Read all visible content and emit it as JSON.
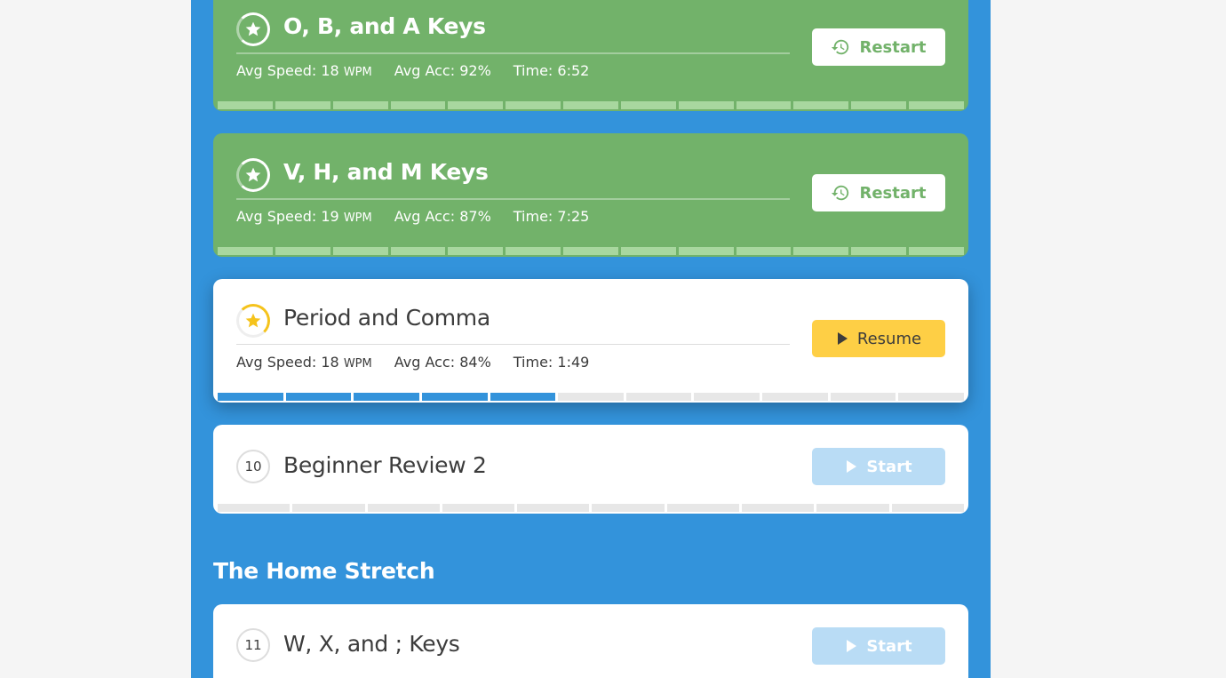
{
  "lessons": [
    {
      "id": "l1",
      "title": "O, B, and A Keys",
      "speed_label": "Avg Speed:",
      "speed_value": "18",
      "speed_unit": "WPM",
      "acc_label": "Avg Acc:",
      "acc_value": "92%",
      "time_label": "Time:",
      "time_value": "6:52",
      "button_label": "Restart",
      "state": "complete",
      "segments_total": 13,
      "segments_done": 13
    },
    {
      "id": "l2",
      "title": "V, H, and M Keys",
      "speed_label": "Avg Speed:",
      "speed_value": "19",
      "speed_unit": "WPM",
      "acc_label": "Avg Acc:",
      "acc_value": "87%",
      "time_label": "Time:",
      "time_value": "7:25",
      "button_label": "Restart",
      "state": "complete",
      "segments_total": 13,
      "segments_done": 13
    },
    {
      "id": "l3",
      "title": "Period and Comma",
      "speed_label": "Avg Speed:",
      "speed_value": "18",
      "speed_unit": "WPM",
      "acc_label": "Avg Acc:",
      "acc_value": "84%",
      "time_label": "Time:",
      "time_value": "1:49",
      "button_label": "Resume",
      "state": "in-progress",
      "segments_total": 11,
      "segments_done": 5
    },
    {
      "id": "l4",
      "number": "10",
      "title": "Beginner Review 2",
      "button_label": "Start",
      "state": "locked",
      "segments_total": 10,
      "segments_done": 0
    }
  ],
  "section": {
    "title": "The Home Stretch"
  },
  "next_lesson": {
    "number": "11",
    "title": "W, X, and ; Keys",
    "button_label": "Start"
  },
  "colors": {
    "page_bg": "#f5f5f5",
    "column_bg": "#3393db",
    "complete_card": "#72b26a",
    "resume_button": "#fecf45",
    "start_button_disabled": "#b9dcf5",
    "progress_done": "#3393db"
  },
  "icons": {
    "complete_badge": "star-icon",
    "in_progress_badge": "star-icon",
    "restart": "history-icon",
    "play": "play-icon"
  }
}
